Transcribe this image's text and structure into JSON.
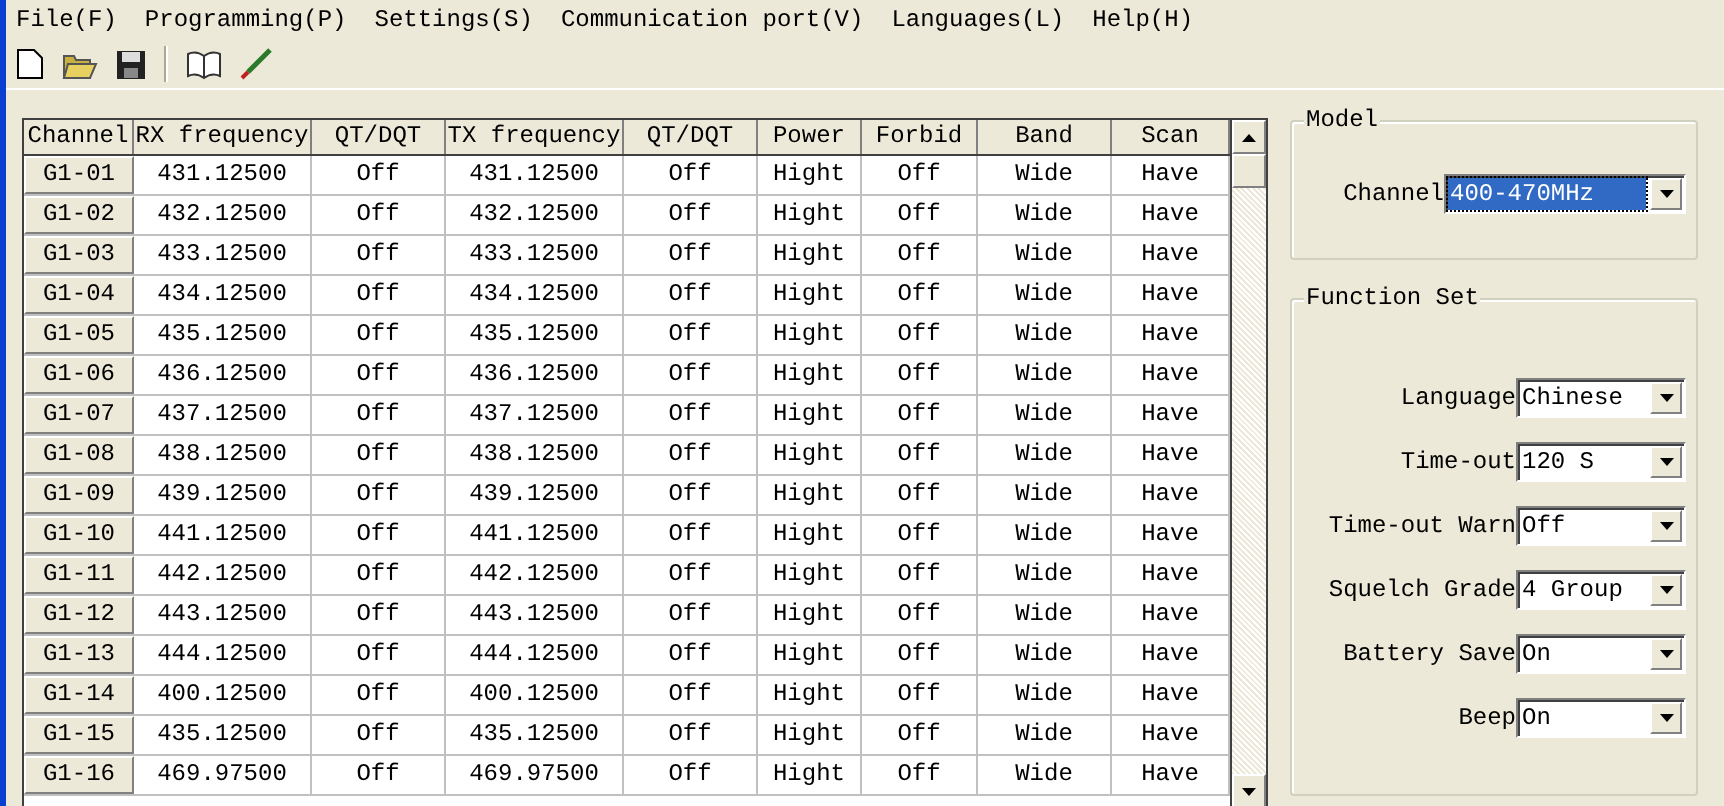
{
  "menu": [
    "File(F)",
    "Programming(P)",
    "Settings(S)",
    "Communication port(V)",
    "Languages(L)",
    "Help(H)"
  ],
  "table": {
    "columns": [
      "Channel",
      "RX frequency",
      "QT/DQT",
      "TX frequency",
      "QT/DQT",
      "Power",
      "Forbid",
      "Band",
      "Scan"
    ],
    "rows": [
      [
        "G1-01",
        "431.12500",
        "Off",
        "431.12500",
        "Off",
        "Hight",
        "Off",
        "Wide",
        "Have"
      ],
      [
        "G1-02",
        "432.12500",
        "Off",
        "432.12500",
        "Off",
        "Hight",
        "Off",
        "Wide",
        "Have"
      ],
      [
        "G1-03",
        "433.12500",
        "Off",
        "433.12500",
        "Off",
        "Hight",
        "Off",
        "Wide",
        "Have"
      ],
      [
        "G1-04",
        "434.12500",
        "Off",
        "434.12500",
        "Off",
        "Hight",
        "Off",
        "Wide",
        "Have"
      ],
      [
        "G1-05",
        "435.12500",
        "Off",
        "435.12500",
        "Off",
        "Hight",
        "Off",
        "Wide",
        "Have"
      ],
      [
        "G1-06",
        "436.12500",
        "Off",
        "436.12500",
        "Off",
        "Hight",
        "Off",
        "Wide",
        "Have"
      ],
      [
        "G1-07",
        "437.12500",
        "Off",
        "437.12500",
        "Off",
        "Hight",
        "Off",
        "Wide",
        "Have"
      ],
      [
        "G1-08",
        "438.12500",
        "Off",
        "438.12500",
        "Off",
        "Hight",
        "Off",
        "Wide",
        "Have"
      ],
      [
        "G1-09",
        "439.12500",
        "Off",
        "439.12500",
        "Off",
        "Hight",
        "Off",
        "Wide",
        "Have"
      ],
      [
        "G1-10",
        "441.12500",
        "Off",
        "441.12500",
        "Off",
        "Hight",
        "Off",
        "Wide",
        "Have"
      ],
      [
        "G1-11",
        "442.12500",
        "Off",
        "442.12500",
        "Off",
        "Hight",
        "Off",
        "Wide",
        "Have"
      ],
      [
        "G1-12",
        "443.12500",
        "Off",
        "443.12500",
        "Off",
        "Hight",
        "Off",
        "Wide",
        "Have"
      ],
      [
        "G1-13",
        "444.12500",
        "Off",
        "444.12500",
        "Off",
        "Hight",
        "Off",
        "Wide",
        "Have"
      ],
      [
        "G1-14",
        "400.12500",
        "Off",
        "400.12500",
        "Off",
        "Hight",
        "Off",
        "Wide",
        "Have"
      ],
      [
        "G1-15",
        "435.12500",
        "Off",
        "435.12500",
        "Off",
        "Hight",
        "Off",
        "Wide",
        "Have"
      ],
      [
        "G1-16",
        "469.97500",
        "Off",
        "469.97500",
        "Off",
        "Hight",
        "Off",
        "Wide",
        "Have"
      ]
    ]
  },
  "model": {
    "title": "Model",
    "label": "Channel",
    "value": "400-470MHz",
    "focused": true
  },
  "function_set": {
    "title": "Function Set",
    "fields": [
      {
        "label": "Language",
        "value": "Chinese"
      },
      {
        "label": "Time-out",
        "value": "120 S"
      },
      {
        "label": "Time-out Warn",
        "value": "Off"
      },
      {
        "label": "Squelch Grade",
        "value": "4 Group"
      },
      {
        "label": "Battery Save",
        "value": "On"
      },
      {
        "label": "Beep",
        "value": "On"
      }
    ]
  }
}
